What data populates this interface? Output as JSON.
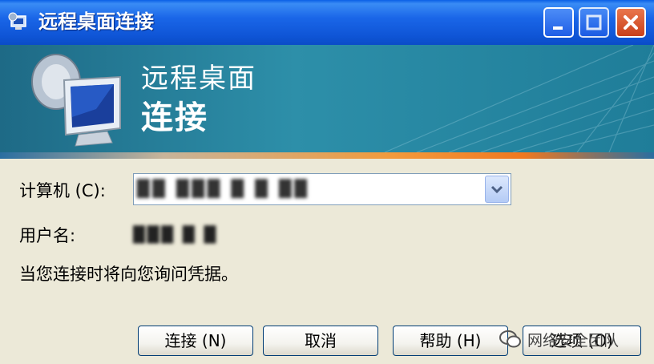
{
  "window": {
    "title": "远程桌面连接",
    "controls": {
      "minimize": "minimize",
      "maximize": "maximize",
      "close": "close"
    }
  },
  "banner": {
    "line1": "远程桌面",
    "line2": "连接"
  },
  "form": {
    "computer_label": "计算机 (C):",
    "computer_value": "██ ███ █ █ ██",
    "username_label": "用户名:",
    "username_value": "███ █ █",
    "credentials_note": "当您连接时将向您询问凭据。"
  },
  "buttons": {
    "connect": "连接 (N)",
    "cancel": "取消",
    "help": "帮助 (H)",
    "options": "选项 (O)"
  },
  "watermark": {
    "text": "网络安全团队"
  },
  "colors": {
    "titlebar": "#0f55d6",
    "banner": "#2d8fa9",
    "accent_orange": "#f07820",
    "dialog_bg": "#ece9d8",
    "close_button": "#c9401b"
  }
}
